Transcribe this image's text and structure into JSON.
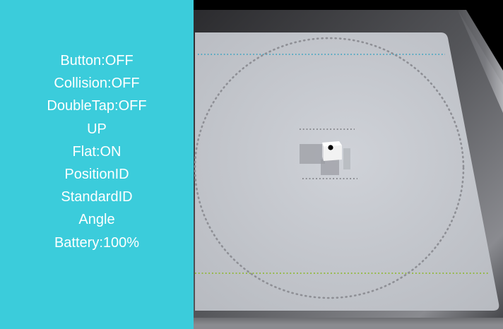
{
  "panel": {
    "background": "#3BCCDB",
    "lines": [
      "Button:OFF",
      "Collision:OFF",
      "DoubleTap:OFF",
      "UP",
      "Flat:ON",
      "PositionID",
      "StandardID",
      "Angle",
      "Battery:100%"
    ]
  },
  "scene": {
    "mat_color": "#C9CCD2",
    "frame_color": "#4A4A4E",
    "boundary_top_color": "#2B9FC0",
    "boundary_bottom_color": "#8DB82E",
    "circle_color": "#8E8F95",
    "robot": {
      "body_color": "#F2F2F2",
      "marker_color": "#000000"
    }
  }
}
